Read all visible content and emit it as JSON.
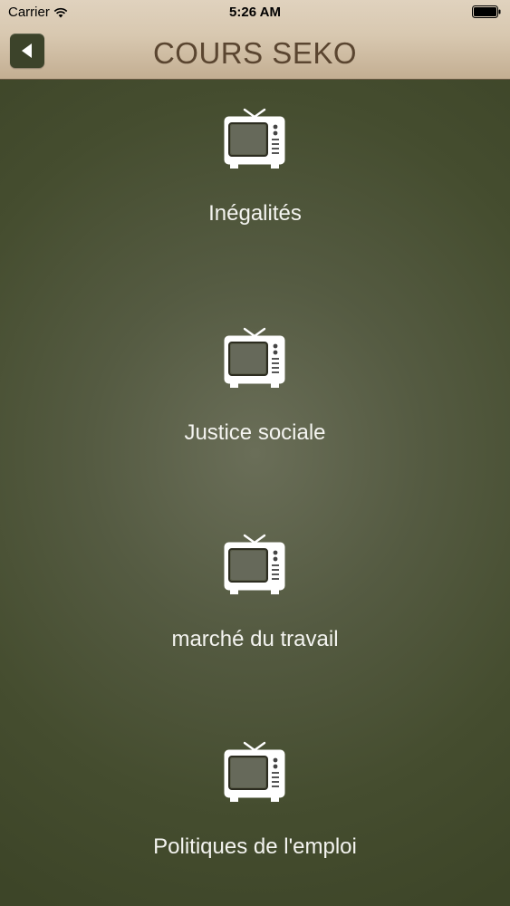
{
  "status_bar": {
    "carrier": "Carrier",
    "time": "5:26 AM",
    "wifi_icon": "wifi-icon",
    "battery_icon": "battery-icon"
  },
  "nav_bar": {
    "title": "COURS SEKO",
    "back_icon": "back-arrow-icon"
  },
  "courses": [
    {
      "label": "Inégalités",
      "icon": "tv-icon"
    },
    {
      "label": "Justice sociale",
      "icon": "tv-icon"
    },
    {
      "label": "marché du travail",
      "icon": "tv-icon"
    },
    {
      "label": "Politiques de l'emploi",
      "icon": "tv-icon"
    }
  ],
  "colors": {
    "header_tan": "#d8c8b0",
    "title_brown": "#5a4530",
    "background_olive": "#454d2f",
    "back_button": "#3c432a",
    "label_white": "#f4f4f0"
  }
}
